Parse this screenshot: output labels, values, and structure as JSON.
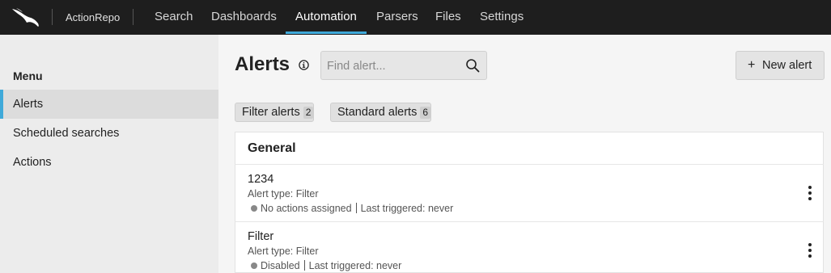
{
  "topbar": {
    "logo_icon": "falcon-logo-icon",
    "repo_name": "ActionRepo",
    "tabs": [
      {
        "label": "Search",
        "active": false
      },
      {
        "label": "Dashboards",
        "active": false
      },
      {
        "label": "Automation",
        "active": true
      },
      {
        "label": "Parsers",
        "active": false
      },
      {
        "label": "Files",
        "active": false
      },
      {
        "label": "Settings",
        "active": false
      }
    ],
    "accent_color": "#3fa9d9"
  },
  "sidebar": {
    "heading": "Menu",
    "items": [
      {
        "label": "Alerts",
        "active": true
      },
      {
        "label": "Scheduled searches",
        "active": false
      },
      {
        "label": "Actions",
        "active": false
      }
    ]
  },
  "main": {
    "title": "Alerts",
    "info_icon": "info-icon",
    "search": {
      "placeholder": "Find alert...",
      "value": ""
    },
    "new_alert_label": "New alert",
    "filters": [
      {
        "label": "Filter alerts",
        "count": "2"
      },
      {
        "label": "Standard alerts",
        "count": "6"
      }
    ],
    "group_title": "General",
    "alerts": [
      {
        "name": "1234",
        "type": "Alert type: Filter",
        "status": "No actions assigned",
        "last_triggered": "Last triggered: never"
      },
      {
        "name": "Filter",
        "type": "Alert type: Filter",
        "status": "Disabled",
        "last_triggered": "Last triggered: never"
      }
    ]
  }
}
